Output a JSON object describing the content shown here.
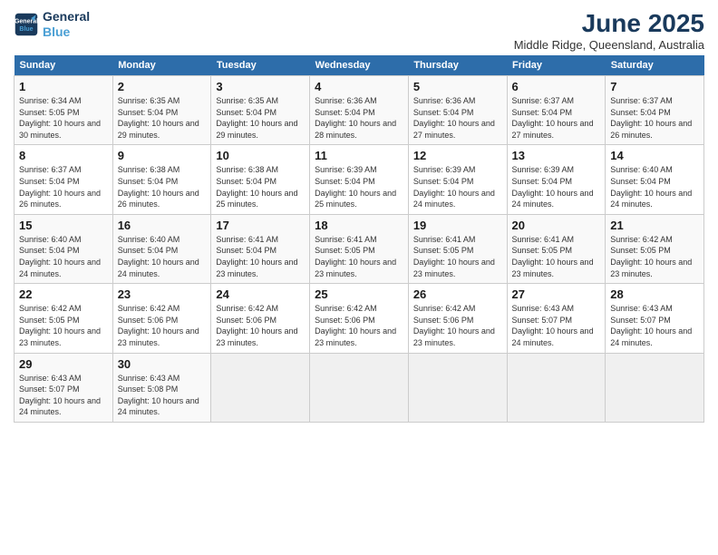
{
  "header": {
    "logo_line1": "General",
    "logo_line2": "Blue",
    "title": "June 2025",
    "location": "Middle Ridge, Queensland, Australia"
  },
  "columns": [
    "Sunday",
    "Monday",
    "Tuesday",
    "Wednesday",
    "Thursday",
    "Friday",
    "Saturday"
  ],
  "weeks": [
    [
      {
        "day": "1",
        "sunrise": "Sunrise: 6:34 AM",
        "sunset": "Sunset: 5:05 PM",
        "daylight": "Daylight: 10 hours and 30 minutes."
      },
      {
        "day": "2",
        "sunrise": "Sunrise: 6:35 AM",
        "sunset": "Sunset: 5:04 PM",
        "daylight": "Daylight: 10 hours and 29 minutes."
      },
      {
        "day": "3",
        "sunrise": "Sunrise: 6:35 AM",
        "sunset": "Sunset: 5:04 PM",
        "daylight": "Daylight: 10 hours and 29 minutes."
      },
      {
        "day": "4",
        "sunrise": "Sunrise: 6:36 AM",
        "sunset": "Sunset: 5:04 PM",
        "daylight": "Daylight: 10 hours and 28 minutes."
      },
      {
        "day": "5",
        "sunrise": "Sunrise: 6:36 AM",
        "sunset": "Sunset: 5:04 PM",
        "daylight": "Daylight: 10 hours and 27 minutes."
      },
      {
        "day": "6",
        "sunrise": "Sunrise: 6:37 AM",
        "sunset": "Sunset: 5:04 PM",
        "daylight": "Daylight: 10 hours and 27 minutes."
      },
      {
        "day": "7",
        "sunrise": "Sunrise: 6:37 AM",
        "sunset": "Sunset: 5:04 PM",
        "daylight": "Daylight: 10 hours and 26 minutes."
      }
    ],
    [
      {
        "day": "8",
        "sunrise": "Sunrise: 6:37 AM",
        "sunset": "Sunset: 5:04 PM",
        "daylight": "Daylight: 10 hours and 26 minutes."
      },
      {
        "day": "9",
        "sunrise": "Sunrise: 6:38 AM",
        "sunset": "Sunset: 5:04 PM",
        "daylight": "Daylight: 10 hours and 26 minutes."
      },
      {
        "day": "10",
        "sunrise": "Sunrise: 6:38 AM",
        "sunset": "Sunset: 5:04 PM",
        "daylight": "Daylight: 10 hours and 25 minutes."
      },
      {
        "day": "11",
        "sunrise": "Sunrise: 6:39 AM",
        "sunset": "Sunset: 5:04 PM",
        "daylight": "Daylight: 10 hours and 25 minutes."
      },
      {
        "day": "12",
        "sunrise": "Sunrise: 6:39 AM",
        "sunset": "Sunset: 5:04 PM",
        "daylight": "Daylight: 10 hours and 24 minutes."
      },
      {
        "day": "13",
        "sunrise": "Sunrise: 6:39 AM",
        "sunset": "Sunset: 5:04 PM",
        "daylight": "Daylight: 10 hours and 24 minutes."
      },
      {
        "day": "14",
        "sunrise": "Sunrise: 6:40 AM",
        "sunset": "Sunset: 5:04 PM",
        "daylight": "Daylight: 10 hours and 24 minutes."
      }
    ],
    [
      {
        "day": "15",
        "sunrise": "Sunrise: 6:40 AM",
        "sunset": "Sunset: 5:04 PM",
        "daylight": "Daylight: 10 hours and 24 minutes."
      },
      {
        "day": "16",
        "sunrise": "Sunrise: 6:40 AM",
        "sunset": "Sunset: 5:04 PM",
        "daylight": "Daylight: 10 hours and 24 minutes."
      },
      {
        "day": "17",
        "sunrise": "Sunrise: 6:41 AM",
        "sunset": "Sunset: 5:04 PM",
        "daylight": "Daylight: 10 hours and 23 minutes."
      },
      {
        "day": "18",
        "sunrise": "Sunrise: 6:41 AM",
        "sunset": "Sunset: 5:05 PM",
        "daylight": "Daylight: 10 hours and 23 minutes."
      },
      {
        "day": "19",
        "sunrise": "Sunrise: 6:41 AM",
        "sunset": "Sunset: 5:05 PM",
        "daylight": "Daylight: 10 hours and 23 minutes."
      },
      {
        "day": "20",
        "sunrise": "Sunrise: 6:41 AM",
        "sunset": "Sunset: 5:05 PM",
        "daylight": "Daylight: 10 hours and 23 minutes."
      },
      {
        "day": "21",
        "sunrise": "Sunrise: 6:42 AM",
        "sunset": "Sunset: 5:05 PM",
        "daylight": "Daylight: 10 hours and 23 minutes."
      }
    ],
    [
      {
        "day": "22",
        "sunrise": "Sunrise: 6:42 AM",
        "sunset": "Sunset: 5:05 PM",
        "daylight": "Daylight: 10 hours and 23 minutes."
      },
      {
        "day": "23",
        "sunrise": "Sunrise: 6:42 AM",
        "sunset": "Sunset: 5:06 PM",
        "daylight": "Daylight: 10 hours and 23 minutes."
      },
      {
        "day": "24",
        "sunrise": "Sunrise: 6:42 AM",
        "sunset": "Sunset: 5:06 PM",
        "daylight": "Daylight: 10 hours and 23 minutes."
      },
      {
        "day": "25",
        "sunrise": "Sunrise: 6:42 AM",
        "sunset": "Sunset: 5:06 PM",
        "daylight": "Daylight: 10 hours and 23 minutes."
      },
      {
        "day": "26",
        "sunrise": "Sunrise: 6:42 AM",
        "sunset": "Sunset: 5:06 PM",
        "daylight": "Daylight: 10 hours and 23 minutes."
      },
      {
        "day": "27",
        "sunrise": "Sunrise: 6:43 AM",
        "sunset": "Sunset: 5:07 PM",
        "daylight": "Daylight: 10 hours and 24 minutes."
      },
      {
        "day": "28",
        "sunrise": "Sunrise: 6:43 AM",
        "sunset": "Sunset: 5:07 PM",
        "daylight": "Daylight: 10 hours and 24 minutes."
      }
    ],
    [
      {
        "day": "29",
        "sunrise": "Sunrise: 6:43 AM",
        "sunset": "Sunset: 5:07 PM",
        "daylight": "Daylight: 10 hours and 24 minutes."
      },
      {
        "day": "30",
        "sunrise": "Sunrise: 6:43 AM",
        "sunset": "Sunset: 5:08 PM",
        "daylight": "Daylight: 10 hours and 24 minutes."
      },
      null,
      null,
      null,
      null,
      null
    ]
  ]
}
